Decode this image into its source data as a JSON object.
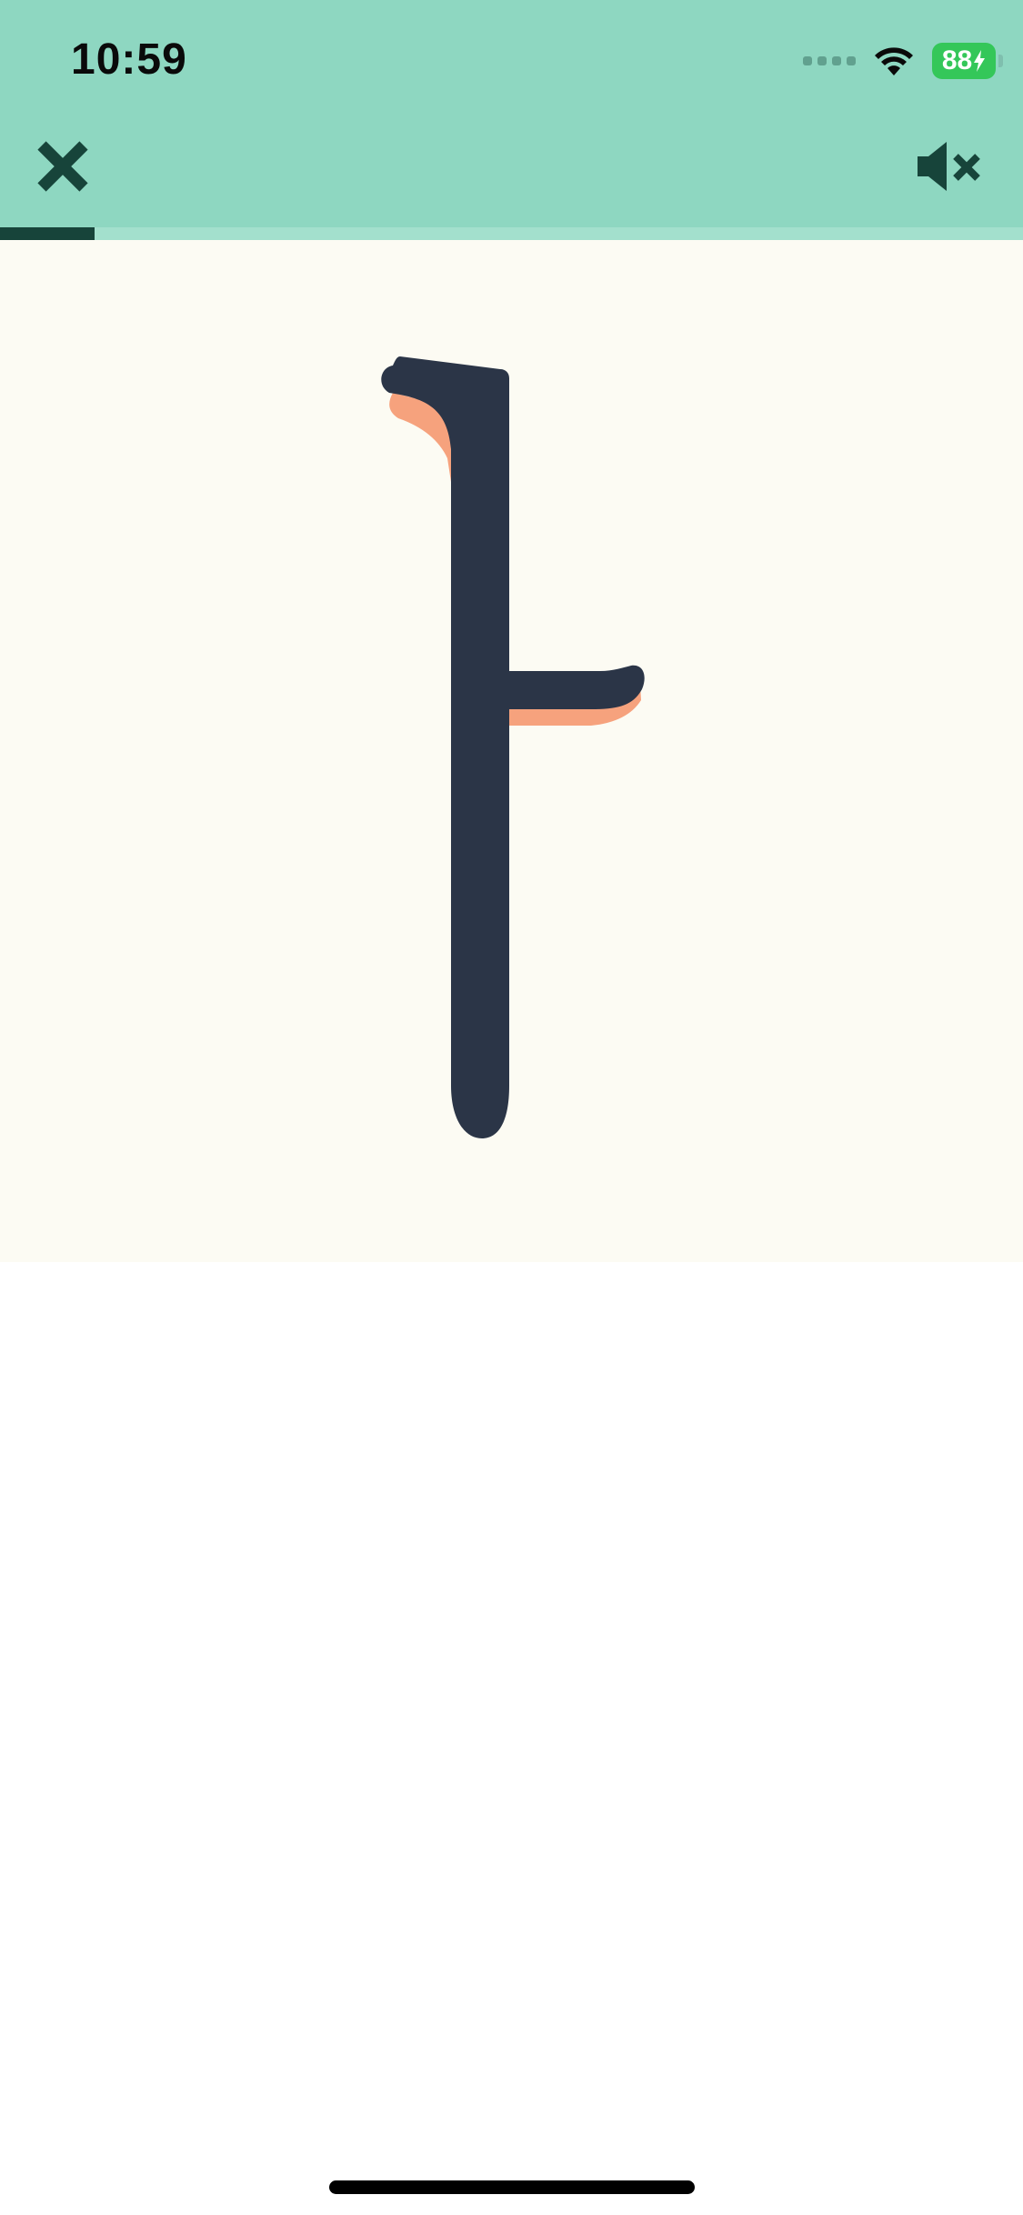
{
  "status_bar": {
    "time": "10:59",
    "battery_level": "88"
  },
  "toolbar": {
    "close_icon": "close-icon",
    "mute_icon": "speaker-muted-icon"
  },
  "progress": {
    "fraction": 0.092
  },
  "letter": {
    "glyph": "ㅏ",
    "stroke_color": "#2b3547",
    "shadow_color": "#f6a27d"
  },
  "colors": {
    "header_bg": "#8ed7c1",
    "progress_fill": "#17443a",
    "panel_bg": "#fcfbf3",
    "battery_green": "#34c759"
  }
}
